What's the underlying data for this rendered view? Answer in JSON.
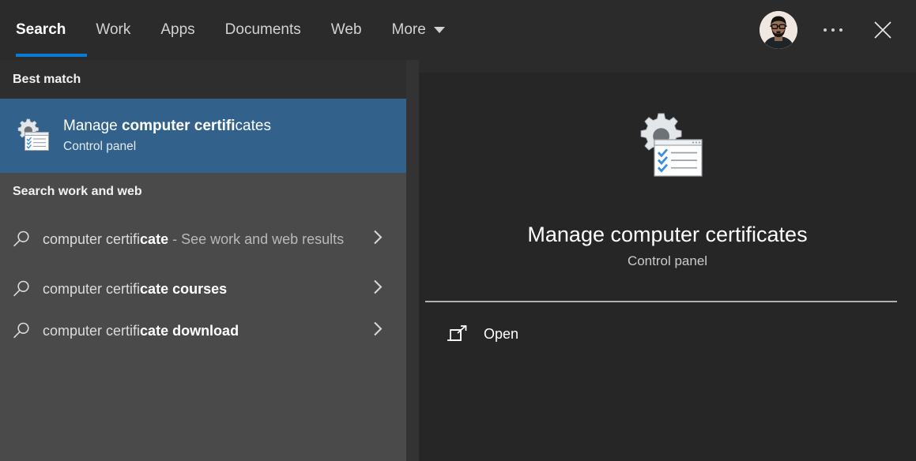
{
  "header": {
    "tabs": [
      {
        "label": "Search",
        "active": true
      },
      {
        "label": "Work",
        "active": false
      },
      {
        "label": "Apps",
        "active": false
      },
      {
        "label": "Documents",
        "active": false
      },
      {
        "label": "Web",
        "active": false
      },
      {
        "label": "More",
        "active": false,
        "has_caret": true
      }
    ],
    "avatar_name": "user-avatar",
    "more_options_label": "…",
    "close_label": "✕"
  },
  "left_pane": {
    "best_match_heading": "Best match",
    "best_match": {
      "title_prefix": "Manage ",
      "title_bold": "computer certifi",
      "title_suffix": "cates",
      "subtitle": "Control panel",
      "icon": "certificates-icon"
    },
    "web_heading": "Search work and web",
    "suggestions": [
      {
        "query_part": "computer certifi",
        "bold_part": "cate",
        "trailing": " - See work and web results",
        "icon": "search-icon",
        "chevron": "chevron-right-icon"
      },
      {
        "query_part": "computer certifi",
        "bold_part": "cate courses",
        "trailing": "",
        "icon": "search-icon",
        "chevron": "chevron-right-icon"
      },
      {
        "query_part": "computer certifi",
        "bold_part": "cate download",
        "trailing": "",
        "icon": "search-icon",
        "chevron": "chevron-right-icon"
      }
    ]
  },
  "detail_pane": {
    "icon": "certificates-icon-large",
    "title": "Manage computer certificates",
    "subtitle": "Control panel",
    "actions": [
      {
        "label": "Open",
        "icon": "open-external-icon"
      }
    ]
  },
  "colors": {
    "accent": "#0a7bd5",
    "selection": "#32628c",
    "header_bg": "#2b2b2b",
    "left_pane_bg": "#4a4a4a",
    "detail_bg": "#262626",
    "check_blue": "#3a8fd8"
  }
}
